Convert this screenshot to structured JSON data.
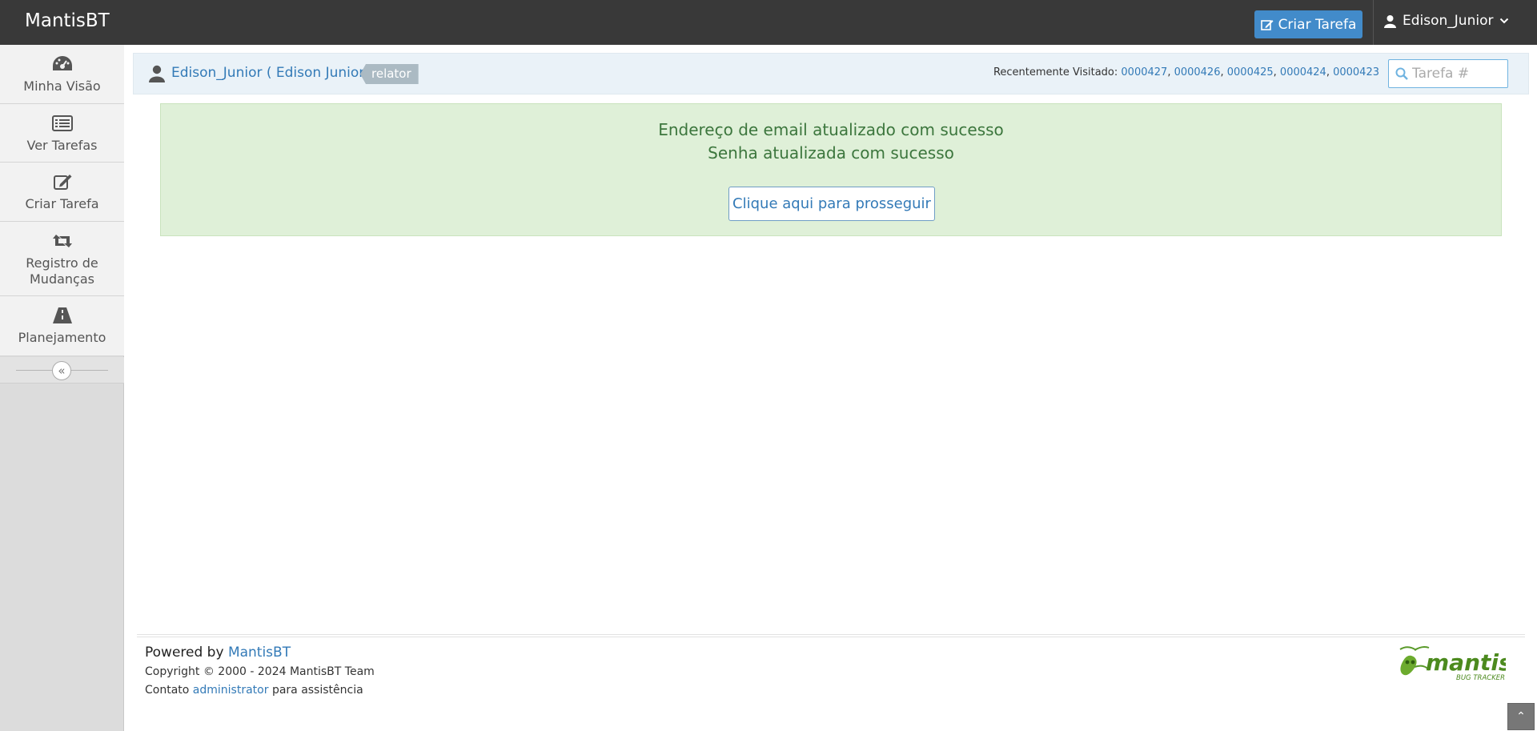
{
  "navbar": {
    "brand": "MantisBT",
    "create_button": "Criar Tarefa",
    "user": "Edison_Junior"
  },
  "sidebar": {
    "items": [
      {
        "label": "Minha Visão",
        "icon": "dashboard-icon"
      },
      {
        "label": "Ver Tarefas",
        "icon": "list-icon"
      },
      {
        "label": "Criar Tarefa",
        "icon": "edit-icon"
      },
      {
        "label": "Registro de Mudanças",
        "icon": "retweet-icon"
      },
      {
        "label": "Planejamento",
        "icon": "road-icon"
      }
    ],
    "collapse_glyph": "«"
  },
  "breadcrumb": {
    "user_text": "Edison_Junior ( Edison Junior )",
    "role": "relator",
    "recent_label": "Recentemente Visitado:",
    "recent_issues": [
      "0000427",
      "0000426",
      "0000425",
      "0000424",
      "0000423"
    ],
    "search_placeholder": "Tarefa #"
  },
  "alert": {
    "line1": "Endereço de email atualizado com sucesso",
    "line2": "Senha atualizada com sucesso",
    "button": "Clique aqui para prosseguir"
  },
  "footer": {
    "powered_by": "Powered by",
    "powered_link": "MantisBT",
    "copyright": "Copyright © 2000 - 2024 MantisBT Team",
    "contact_prefix": "Contato",
    "contact_link": "administrator",
    "contact_suffix": "para assistência",
    "logo_text": "mantis",
    "logo_subtext": "BUG TRACKER",
    "scroll_top_glyph": "⌃"
  },
  "colors": {
    "navbar": "#393939",
    "primary": "#428bca",
    "link": "#337ab7",
    "success_bg": "#dff0d8",
    "success_text": "#3c763d",
    "sidebar_bg": "#f2f2f2"
  }
}
